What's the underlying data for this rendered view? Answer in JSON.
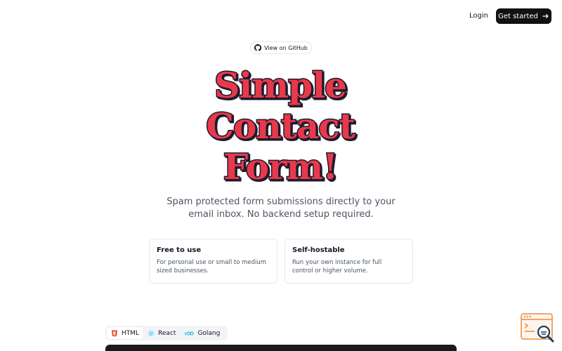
{
  "header": {
    "login_label": "Login",
    "cta_label": "Get started"
  },
  "github_pill": {
    "label": "View on GitHub"
  },
  "hero": {
    "title_lines": [
      "Simple",
      "Contact",
      "Form!"
    ],
    "subtitle_line1": "Spam protected form submissions directly to your",
    "subtitle_line2": "email inbox. No backend setup required."
  },
  "features": [
    {
      "title": "Free to use",
      "desc_line1": "For personal use or small to medium",
      "desc_line2": "sized businesses."
    },
    {
      "title": "Self-hostable",
      "desc_line1": "Run your own instance for full",
      "desc_line2": "control or higher volume."
    }
  ],
  "tabs": [
    {
      "label": "HTML",
      "icon": "html5-icon",
      "active": true
    },
    {
      "label": "React",
      "icon": "react-icon",
      "active": false
    },
    {
      "label": "Golang",
      "icon": "golang-icon",
      "active": false
    }
  ],
  "colors": {
    "title_fill": "#e8394a",
    "title_outline": "#1f1a2e",
    "cta_bg": "#111111",
    "code_panel_bg": "#1a1a1a"
  }
}
